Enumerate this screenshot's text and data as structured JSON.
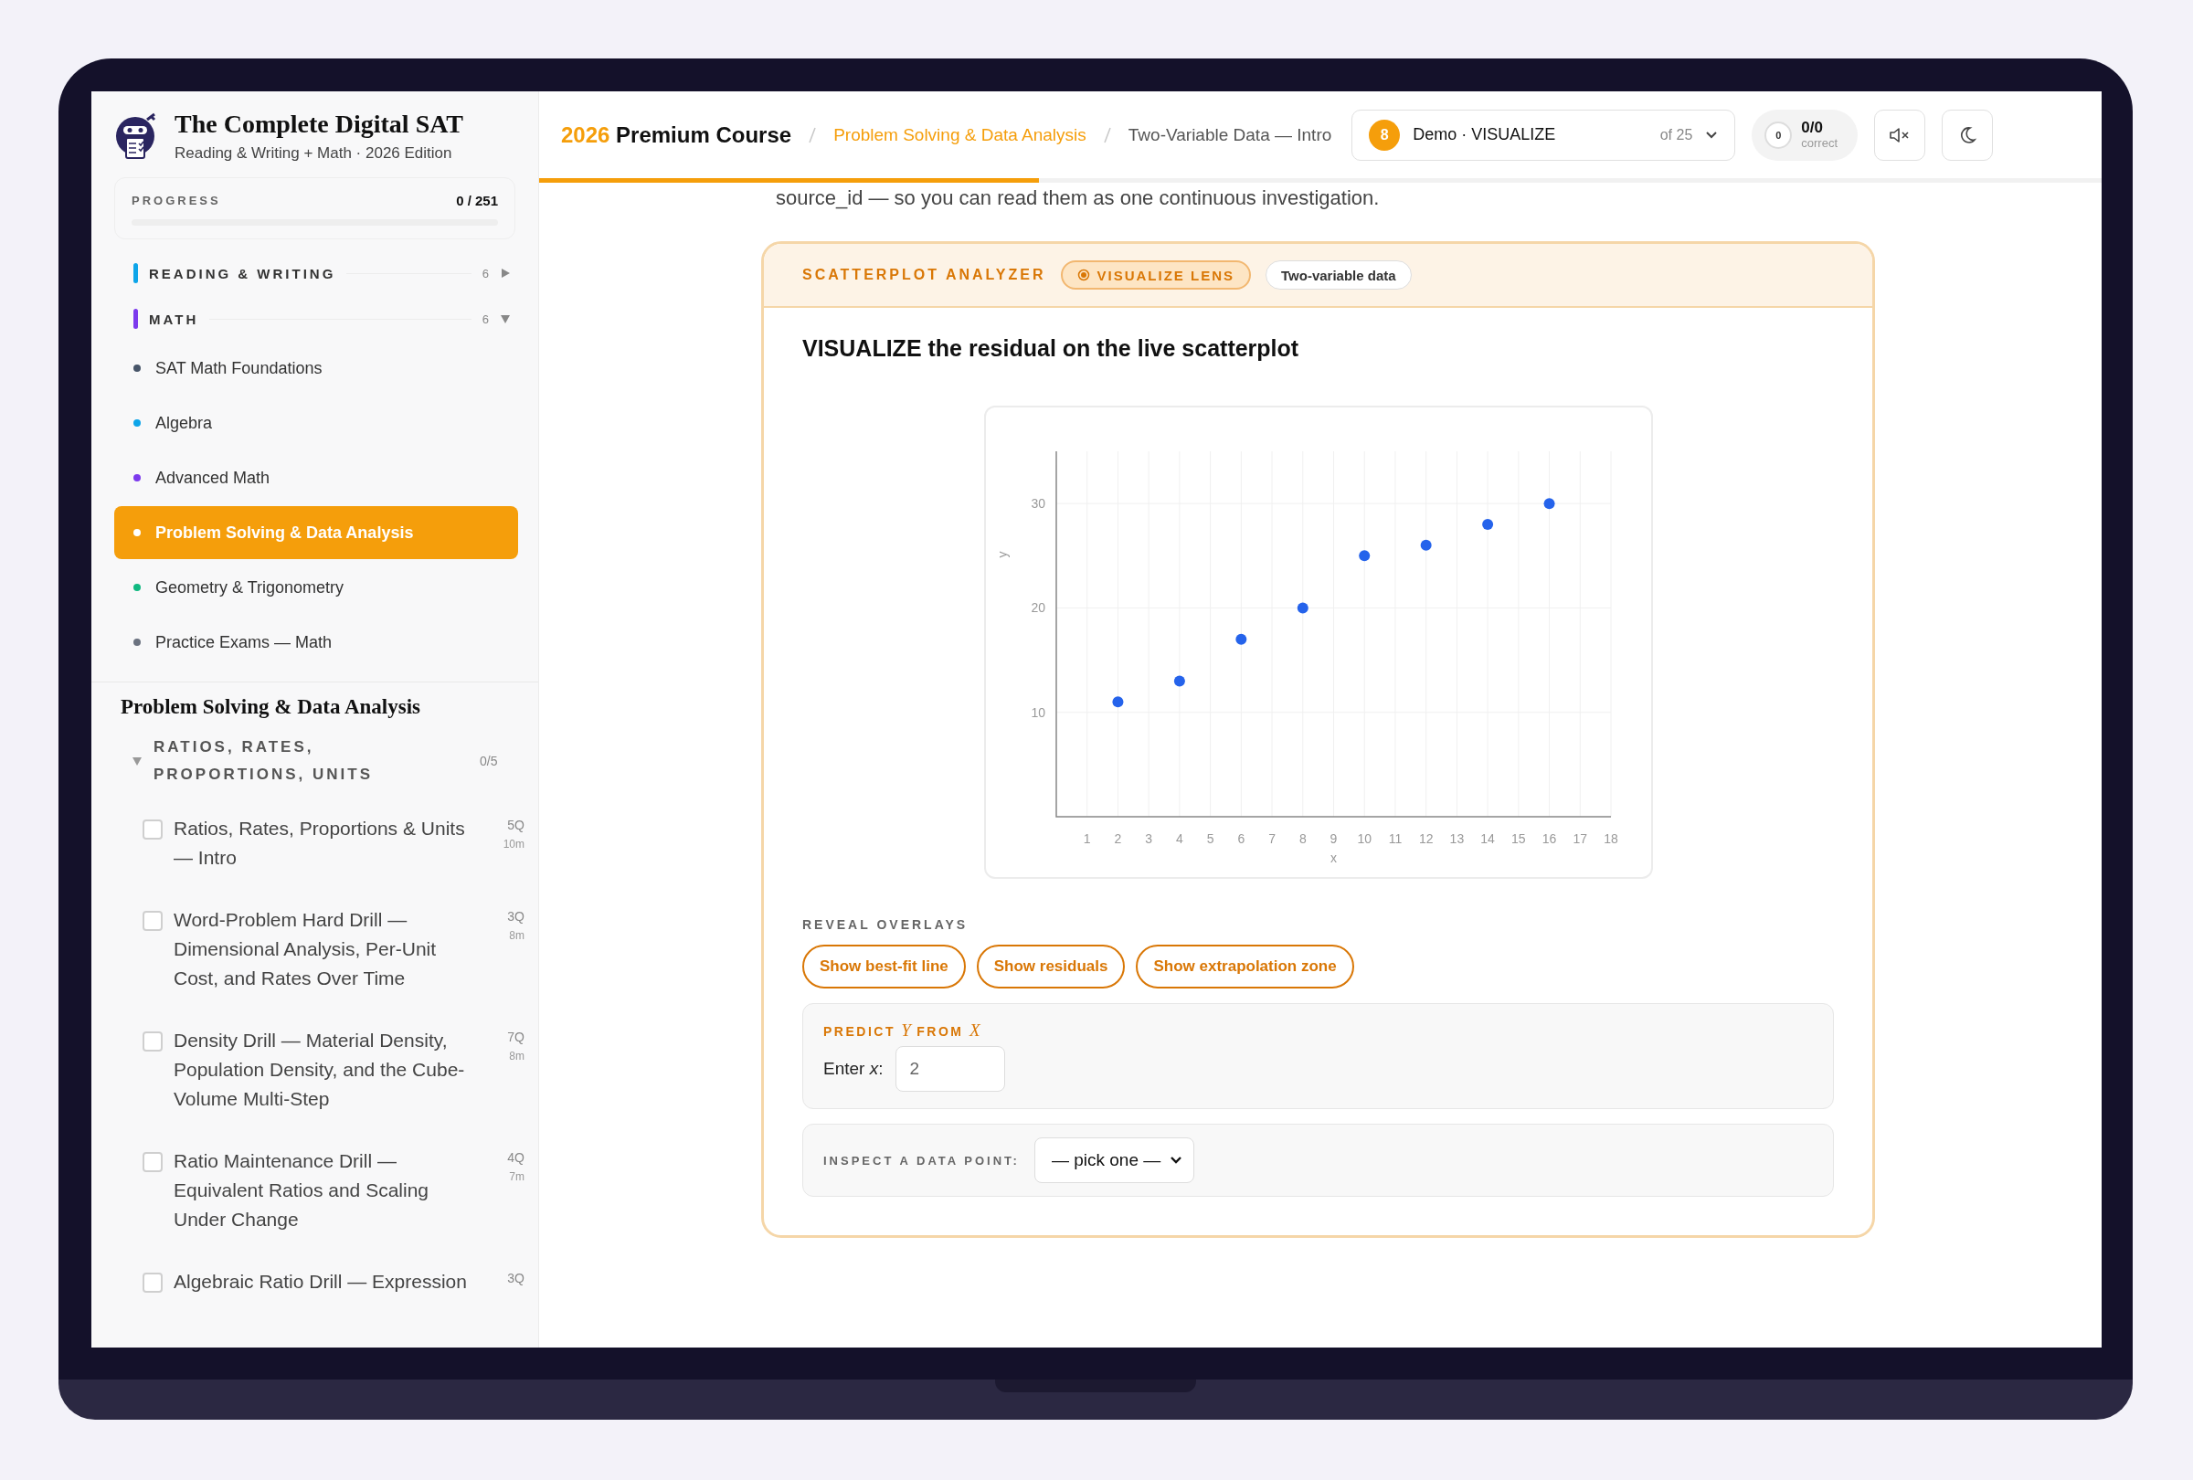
{
  "sidebar": {
    "brand": {
      "title": "The Complete Digital SAT",
      "subtitle": "Reading & Writing + Math · 2026 Edition"
    },
    "progress": {
      "label": "PROGRESS",
      "value": "0 / 251",
      "level": 0
    },
    "sections": [
      {
        "label": "READING & WRITING",
        "count": "6",
        "color": "#0ea5e9",
        "expanded": false
      },
      {
        "label": "MATH",
        "count": "6",
        "color": "#7c3aed",
        "expanded": true
      }
    ],
    "math_items": [
      {
        "label": "SAT Math Foundations",
        "color": "#475569",
        "selected": false
      },
      {
        "label": "Algebra",
        "color": "#0ea5e9",
        "selected": false
      },
      {
        "label": "Advanced Math",
        "color": "#7c3aed",
        "selected": false
      },
      {
        "label": "Problem Solving & Data Analysis",
        "color": "#ffffff",
        "selected": true
      },
      {
        "label": "Geometry & Trigonometry",
        "color": "#10b981",
        "selected": false
      },
      {
        "label": "Practice Exams — Math",
        "color": "#6b7280",
        "selected": false
      }
    ],
    "unit_title": "Problem Solving & Data Analysis",
    "group": {
      "label": "RATIOS, RATES, PROPORTIONS, UNITS",
      "count": "0/5",
      "expanded": true
    },
    "lessons": [
      {
        "title": "Ratios, Rates, Proportions & Units — Intro",
        "questions": "5Q",
        "minutes": "10m",
        "checked": false
      },
      {
        "title": "Word-Problem Hard Drill — Dimensional Analysis, Per-Unit Cost, and Rates Over Time",
        "questions": "3Q",
        "minutes": "8m",
        "checked": false
      },
      {
        "title": "Density Drill — Material Density, Population Density, and the Cube-Volume Multi-Step",
        "questions": "7Q",
        "minutes": "8m",
        "checked": false
      },
      {
        "title": "Ratio Maintenance Drill — Equivalent Ratios and Scaling Under Change",
        "questions": "4Q",
        "minutes": "7m",
        "checked": false
      },
      {
        "title": "Algebraic Ratio Drill — Expression",
        "questions": "3Q",
        "checked": false
      }
    ]
  },
  "topbar": {
    "course_year": "2026",
    "course_name": "Premium Course",
    "breadcrumbs": [
      {
        "label": "Problem Solving & Data Analysis",
        "kind": "link"
      },
      {
        "label": "Two-Variable Data — Intro",
        "kind": "current"
      }
    ],
    "lesson_picker": {
      "number": "8",
      "title": "Demo · VISUALIZE",
      "count": "of 25"
    },
    "score": {
      "ring": "0",
      "value": "0/0",
      "label": "correct"
    },
    "reading_progress": {
      "level": 0.32
    }
  },
  "intro_text": "source_id — so you can read them as one continuous investigation.",
  "analyzer": {
    "title": "SCATTERPLOT ANALYZER",
    "tags": [
      {
        "label": "VISUALIZE LENS",
        "kind": "lens"
      },
      {
        "label": "Two-variable data",
        "kind": "plain"
      }
    ],
    "heading": "VISUALIZE the residual on the live scatterplot",
    "chart_data": {
      "type": "scatter",
      "grid": true,
      "xlabel": "x",
      "ylabel": "y",
      "x": [
        2,
        4,
        6,
        8,
        10,
        12,
        14,
        16
      ],
      "series": [
        {
          "color": "#2563eb",
          "values": [
            11,
            13,
            17,
            20,
            25,
            26,
            28,
            30
          ]
        }
      ],
      "xlim": [
        0,
        18
      ],
      "ylim": [
        0,
        35
      ],
      "xticks": [
        1,
        2,
        3,
        4,
        5,
        6,
        7,
        8,
        9,
        10,
        11,
        12,
        13,
        14,
        15,
        16,
        17,
        18
      ],
      "yticks": [
        10,
        20,
        30
      ]
    },
    "overlays": {
      "label": "REVEAL OVERLAYS",
      "buttons": [
        "Show best-fit line",
        "Show residuals",
        "Show extrapolation zone"
      ]
    },
    "predict": {
      "title": "PREDICT *Y* FROM *X*",
      "label": "Enter *x*:",
      "value": "2"
    },
    "inspect": {
      "label": "INSPECT A DATA POINT:",
      "value": "— pick one —"
    }
  }
}
